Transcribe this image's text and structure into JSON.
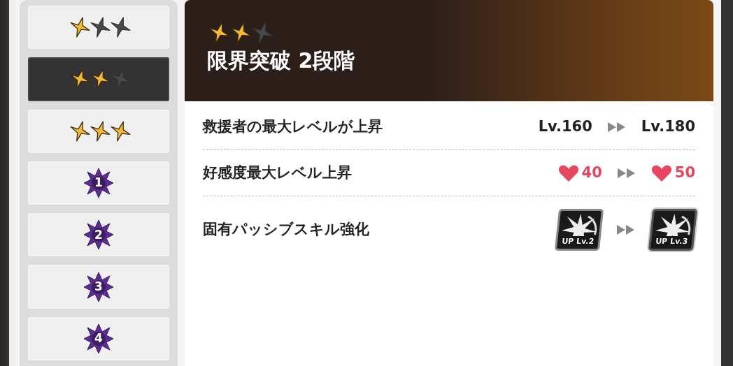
{
  "tiers": [
    {
      "kind": "stars",
      "stars": 1,
      "selected": false
    },
    {
      "kind": "stars",
      "stars": 2,
      "selected": true
    },
    {
      "kind": "stars",
      "stars": 3,
      "selected": false
    },
    {
      "kind": "rank",
      "label": "1",
      "selected": false
    },
    {
      "kind": "rank",
      "label": "2",
      "selected": false
    },
    {
      "kind": "rank",
      "label": "3",
      "selected": false
    },
    {
      "kind": "rank",
      "label": "4",
      "selected": false
    }
  ],
  "header": {
    "stars": 2,
    "title": "限界突破 2段階"
  },
  "bonuses": [
    {
      "kind": "level",
      "label": "救援者の最大レベルが上昇",
      "from": "Lv.160",
      "to": "Lv.180"
    },
    {
      "kind": "affection",
      "label": "好感度最大レベル上昇",
      "from": "40",
      "to": "50"
    },
    {
      "kind": "skill",
      "label": "固有パッシブスキル強化",
      "from": "UP Lv.2",
      "to": "UP Lv.3"
    }
  ]
}
